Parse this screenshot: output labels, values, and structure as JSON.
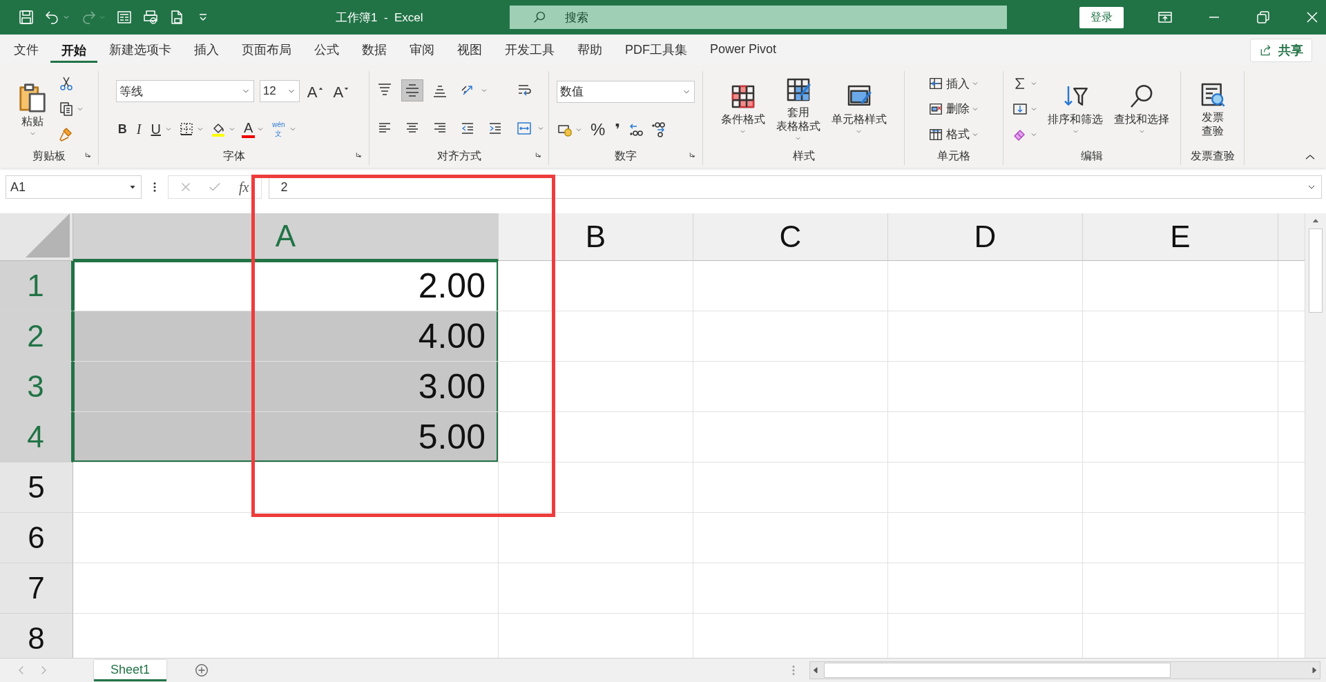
{
  "title_bar": {
    "quick_access": [
      {
        "kind": "save",
        "dropdown": false,
        "disabled": false
      },
      {
        "kind": "undo",
        "dropdown": true,
        "disabled": false
      },
      {
        "kind": "redo",
        "dropdown": true,
        "disabled": true
      },
      {
        "kind": "form",
        "dropdown": false,
        "disabled": false
      },
      {
        "kind": "print",
        "dropdown": false,
        "disabled": false
      },
      {
        "kind": "page",
        "dropdown": false,
        "disabled": false
      },
      {
        "kind": "customize",
        "dropdown": false,
        "disabled": false
      }
    ],
    "document_title": "工作簿1  -  Excel",
    "search_placeholder": "搜索",
    "sign_in": "登录"
  },
  "ribbon_tabs": [
    {
      "label": "文件",
      "selected": false
    },
    {
      "label": "开始",
      "selected": true
    },
    {
      "label": "新建选项卡",
      "selected": false
    },
    {
      "label": "插入",
      "selected": false
    },
    {
      "label": "页面布局",
      "selected": false
    },
    {
      "label": "公式",
      "selected": false
    },
    {
      "label": "数据",
      "selected": false
    },
    {
      "label": "审阅",
      "selected": false
    },
    {
      "label": "视图",
      "selected": false
    },
    {
      "label": "开发工具",
      "selected": false
    },
    {
      "label": "帮助",
      "selected": false
    },
    {
      "label": "PDF工具集",
      "selected": false
    },
    {
      "label": "Power Pivot",
      "selected": false
    }
  ],
  "share_button": "共享",
  "ribbon_groups": [
    {
      "title": "剪贴板",
      "launcher": true,
      "stacks": [
        {
          "lines": [
            {
              "controls": [
                {
                  "kind": "paste",
                  "lines": [
                    "粘贴"
                  ],
                  "dropdown": true
                }
              ]
            }
          ]
        },
        {
          "lines": [
            {
              "controls": [
                {
                  "kind": "cut",
                  "dropdown": false
                }
              ]
            },
            {
              "controls": [
                {
                  "kind": "copy",
                  "dropdown": true
                }
              ]
            },
            {
              "controls": [
                {
                  "kind": "format-painter",
                  "dropdown": false
                }
              ]
            }
          ]
        }
      ]
    },
    {
      "title": "字体",
      "launcher": true,
      "stacks": [
        {
          "lines": [
            {
              "controls": [
                {
                  "kind": "combo",
                  "value": "等线",
                  "wide": true
                },
                {
                  "kind": "combo",
                  "value": "12",
                  "wide": false
                },
                {
                  "kind": "grow-font",
                  "label": "A",
                  "dropdown": false
                },
                {
                  "kind": "shrink-font",
                  "label": "A",
                  "dropdown": false
                }
              ]
            },
            {
              "controls": [
                {
                  "kind": "bold",
                  "label": "B",
                  "dropdown": false
                },
                {
                  "kind": "italic",
                  "label": "I",
                  "dropdown": false
                },
                {
                  "kind": "underline",
                  "label": "U",
                  "dropdown": true
                },
                {
                  "kind": "borders",
                  "dropdown": true
                },
                {
                  "kind": "fill-color",
                  "dropdown": true
                },
                {
                  "kind": "font-color",
                  "label": "A",
                  "dropdown": true
                },
                {
                  "kind": "phonetic",
                  "lines": [
                    "wén",
                    "文"
                  ],
                  "dropdown": true
                }
              ]
            }
          ]
        }
      ]
    },
    {
      "title": "对齐方式",
      "launcher": true,
      "stacks": [
        {
          "lines": [
            {
              "controls": [
                {
                  "kind": "align-top",
                  "selected": false,
                  "dropdown": false
                },
                {
                  "kind": "align-middle",
                  "selected": true,
                  "dropdown": false
                },
                {
                  "kind": "align-bottom",
                  "selected": false,
                  "dropdown": false
                },
                {
                  "kind": "orientation",
                  "selected": false,
                  "dropdown": true
                }
              ]
            },
            {
              "controls": [
                {
                  "kind": "align-left",
                  "selected": false,
                  "dropdown": false
                },
                {
                  "kind": "align-center",
                  "selected": false,
                  "dropdown": false
                },
                {
                  "kind": "align-right",
                  "selected": false,
                  "dropdown": false
                },
                {
                  "kind": "outdent",
                  "selected": false,
                  "dropdown": false
                },
                {
                  "kind": "indent",
                  "selected": false,
                  "dropdown": false
                }
              ]
            }
          ]
        },
        {
          "lines": [
            {
              "controls": [
                {
                  "kind": "wrap-text",
                  "selected": false,
                  "dropdown": false
                }
              ]
            },
            {
              "controls": [
                {
                  "kind": "merge",
                  "selected": false,
                  "dropdown": true
                }
              ]
            }
          ]
        }
      ]
    },
    {
      "title": "数字",
      "launcher": true,
      "stacks": [
        {
          "lines": [
            {
              "controls": [
                {
                  "kind": "combo",
                  "value": "数值",
                  "wide": true
                }
              ]
            },
            {
              "controls": [
                {
                  "kind": "accounting",
                  "dropdown": true
                },
                {
                  "kind": "percent",
                  "label": "%",
                  "dropdown": false
                },
                {
                  "kind": "comma",
                  "label": "❜",
                  "dropdown": false
                },
                {
                  "kind": "increase-decimal",
                  "dropdown": false
                },
                {
                  "kind": "decrease-decimal",
                  "dropdown": false
                }
              ]
            }
          ]
        }
      ]
    },
    {
      "title": "样式",
      "launcher": false,
      "stacks": [
        {
          "lines": [
            {
              "controls": [
                {
                  "kind": "conditional",
                  "lines": [
                    "条件格式"
                  ],
                  "dropdown": true
                },
                {
                  "kind": "table-format",
                  "lines": [
                    "套用",
                    "表格格式"
                  ],
                  "dropdown": true
                },
                {
                  "kind": "cell-styles",
                  "lines": [
                    "单元格样式"
                  ],
                  "dropdown": true
                }
              ]
            }
          ]
        }
      ]
    },
    {
      "title": "单元格",
      "launcher": false,
      "stacks": [
        {
          "lines": [
            {
              "controls": [
                {
                  "kind": "insert-cells",
                  "label": "插入",
                  "dropdown": true
                }
              ]
            },
            {
              "controls": [
                {
                  "kind": "delete-cells",
                  "label": "删除",
                  "dropdown": true
                }
              ]
            },
            {
              "controls": [
                {
                  "kind": "format-cells",
                  "label": "格式",
                  "dropdown": true
                }
              ]
            }
          ]
        }
      ]
    },
    {
      "title": "编辑",
      "launcher": false,
      "stacks": [
        {
          "lines": [
            {
              "controls": [
                {
                  "kind": "autosum",
                  "dropdown": true
                }
              ]
            },
            {
              "controls": [
                {
                  "kind": "fill",
                  "dropdown": true
                }
              ]
            },
            {
              "controls": [
                {
                  "kind": "clear",
                  "dropdown": true
                }
              ]
            }
          ]
        },
        {
          "lines": [
            {
              "controls": [
                {
                  "kind": "sort-filter",
                  "lines": [
                    "排序和筛选"
                  ],
                  "dropdown": true
                },
                {
                  "kind": "find",
                  "lines": [
                    "查找和选择"
                  ],
                  "dropdown": true
                }
              ]
            }
          ]
        }
      ]
    },
    {
      "title": "发票查验",
      "launcher": false,
      "stacks": [
        {
          "lines": [
            {
              "controls": [
                {
                  "kind": "invoice",
                  "lines": [
                    "发票",
                    "查验"
                  ],
                  "dropdown": false
                }
              ]
            }
          ]
        }
      ]
    }
  ],
  "formula_bar": {
    "name_box": "A1",
    "function_label": "fx",
    "value": "2"
  },
  "sheet": {
    "columns": [
      {
        "label": "A",
        "selected": true
      },
      {
        "label": "B",
        "selected": false
      },
      {
        "label": "C",
        "selected": false
      },
      {
        "label": "D",
        "selected": false
      },
      {
        "label": "E",
        "selected": false
      }
    ],
    "rows": [
      {
        "label": "1",
        "selected": true,
        "cells": [
          {
            "value": "2.00",
            "selected": true,
            "active": true
          }
        ]
      },
      {
        "label": "2",
        "selected": true,
        "cells": [
          {
            "value": "4.00",
            "selected": true,
            "active": false
          }
        ]
      },
      {
        "label": "3",
        "selected": true,
        "cells": [
          {
            "value": "3.00",
            "selected": true,
            "active": false
          }
        ]
      },
      {
        "label": "4",
        "selected": true,
        "cells": [
          {
            "value": "5.00",
            "selected": true,
            "active": false
          }
        ]
      },
      {
        "label": "5",
        "selected": false,
        "cells": []
      },
      {
        "label": "6",
        "selected": false,
        "cells": []
      },
      {
        "label": "7",
        "selected": false,
        "cells": []
      },
      {
        "label": "8",
        "selected": false,
        "cells": []
      }
    ],
    "tabs": [
      {
        "label": "Sheet1",
        "selected": true
      }
    ]
  },
  "annotations": [
    {
      "kind": "rectangle"
    }
  ]
}
